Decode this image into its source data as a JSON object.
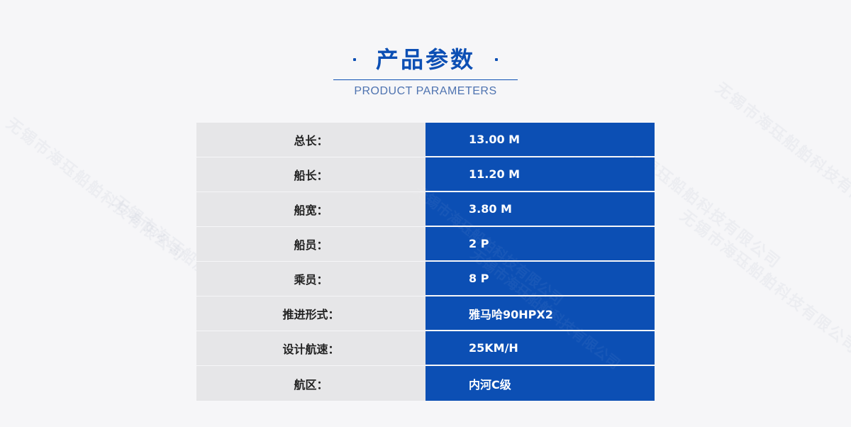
{
  "header": {
    "title": "产品参数",
    "subtitle": "PRODUCT PARAMETERS"
  },
  "params": [
    {
      "label": "总长：",
      "value": "13.00 M"
    },
    {
      "label": "船长：",
      "value": "11.20 M"
    },
    {
      "label": "船宽：",
      "value": "3.80 M"
    },
    {
      "label": "船员：",
      "value": "2 P"
    },
    {
      "label": "乘员：",
      "value": "8 P"
    },
    {
      "label": "推进形式：",
      "value": "雅马哈90HPX2"
    },
    {
      "label": "设计航速：",
      "value": "25KM/H"
    },
    {
      "label": "航区：",
      "value": "内河C级"
    }
  ],
  "watermark": "无锡市海珏船舶科技有限公司",
  "colors": {
    "accent": "#0c4fb4",
    "label_bg": "#e6e6e8",
    "page_bg": "#f6f6f8"
  }
}
